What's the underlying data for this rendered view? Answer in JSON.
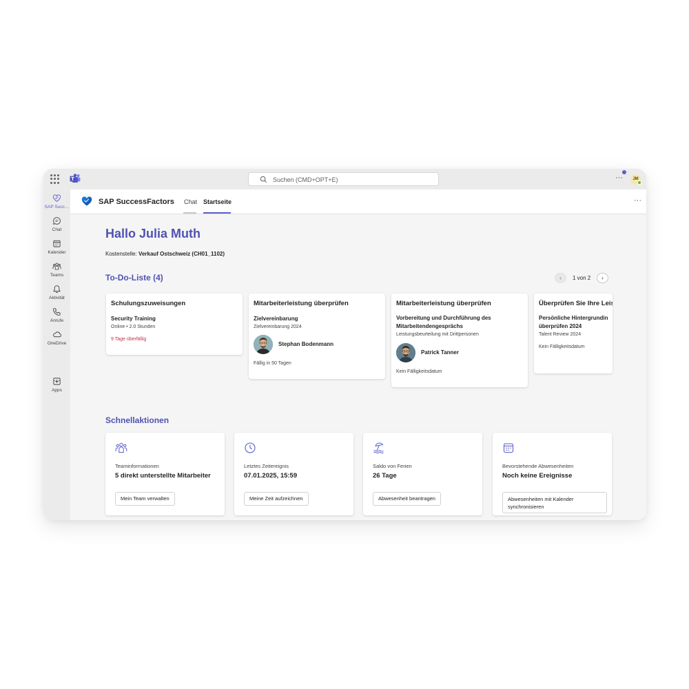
{
  "topbar": {
    "search_placeholder": "Suchen (CMD+OPT+E)",
    "more": "···",
    "avatar_initials": "JM"
  },
  "rail": {
    "items": [
      {
        "label": "SAP Succ…"
      },
      {
        "label": "Chat"
      },
      {
        "label": "Kalender"
      },
      {
        "label": "Teams"
      },
      {
        "label": "Aktivität"
      },
      {
        "label": "Anrufe"
      },
      {
        "label": "OneDrive"
      },
      {
        "label": "Apps"
      }
    ],
    "more": "···"
  },
  "app": {
    "title": "SAP SuccessFactors",
    "tabs": [
      "Chat",
      "Startseite"
    ],
    "more": "···"
  },
  "greeting": "Hallo Julia Muth",
  "cost_center": {
    "label": "Kostenstelle:",
    "value": "Verkauf Ostschweiz (CH01_1102)"
  },
  "todo": {
    "title": "To-Do-Liste (4)",
    "pager": {
      "text": "1 von 2",
      "prev": "‹",
      "next": "›"
    },
    "cards": [
      {
        "title": "Schulungszuweisungen",
        "subtitle": "Security Training",
        "meta": "Online • 2.0 Stunden",
        "status": "9 Tage überfällig"
      },
      {
        "title": "Mitarbeiterleistung überprüfen",
        "subtitle": "Zielvereinbarung",
        "meta": "Zielvereinbarung 2024",
        "person": "Stephan Bodenmann",
        "status": "Fällig in 50 Tagen"
      },
      {
        "title": "Mitarbeiterleistung überprüfen",
        "subtitle_line1": "Vorbereitung und Durchführung des",
        "subtitle_line2": "Mitarbeitendengesprächs",
        "meta": "Leistungsbeurteilung mit Drittpersonen",
        "person": "Patrick Tanner",
        "status": "Kein Fälligkeitsdatum"
      },
      {
        "title": "Überprüfen Sie Ihre Leis",
        "subtitle_line1": "Persönliche Hintergrundin",
        "subtitle_line2": "überprüfen 2024",
        "meta": "Talent Review 2024",
        "status": "Kein Fälligkeitsdatum"
      }
    ]
  },
  "quick": {
    "title": "Schnellaktionen",
    "cards": [
      {
        "label": "Teaminformationen",
        "value": "5 direkt unterstellte Mitarbeiter",
        "button": "Mein Team verwalten"
      },
      {
        "label": "Letztes Zeitereignis",
        "value": "07.01.2025, 15:59",
        "button": "Meine Zeit aufzeichnen"
      },
      {
        "label": "Saldo von Ferien",
        "value": "26 Tage",
        "button": "Abwesenheit beantragen"
      },
      {
        "label": "Bevorstehende Abwesenheiten",
        "value": "Noch keine Ereignisse",
        "button": "Abwesenheiten mit Kalender synchronisieren"
      }
    ]
  },
  "colors": {
    "accent": "#5b5fc7",
    "heading": "#4f52b2",
    "overdue": "#c4314b"
  }
}
